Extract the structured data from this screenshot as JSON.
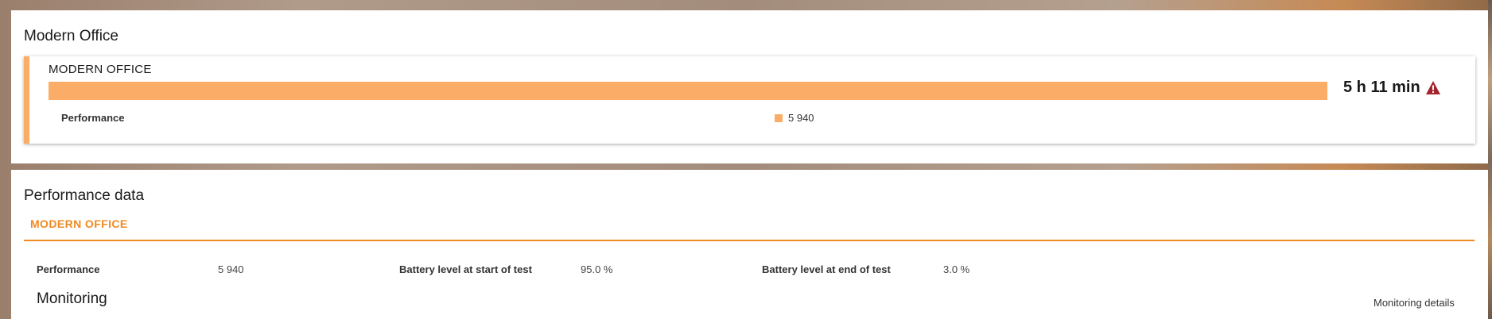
{
  "top_section": {
    "title": "Modern Office",
    "card": {
      "title": "MODERN OFFICE",
      "bar_fill_fraction": 1.0,
      "result": "5 h 11 min",
      "result_icon": "warning-triangle-icon",
      "metric_label": "Performance",
      "legend_value": "5 940",
      "accent_color": "#fbad68",
      "warning_color": "#a3252c"
    }
  },
  "performance_data": {
    "title": "Performance data",
    "tab_label": "MODERN OFFICE",
    "tab_color": "#ef8a22",
    "fields": [
      {
        "label": "Performance",
        "value": "5 940"
      },
      {
        "label": "Battery level at start of test",
        "value": "95.0 %"
      },
      {
        "label": "Battery level at end of test",
        "value": "3.0 %"
      }
    ],
    "monitoring_title": "Monitoring",
    "monitoring_link": "Monitoring details"
  }
}
